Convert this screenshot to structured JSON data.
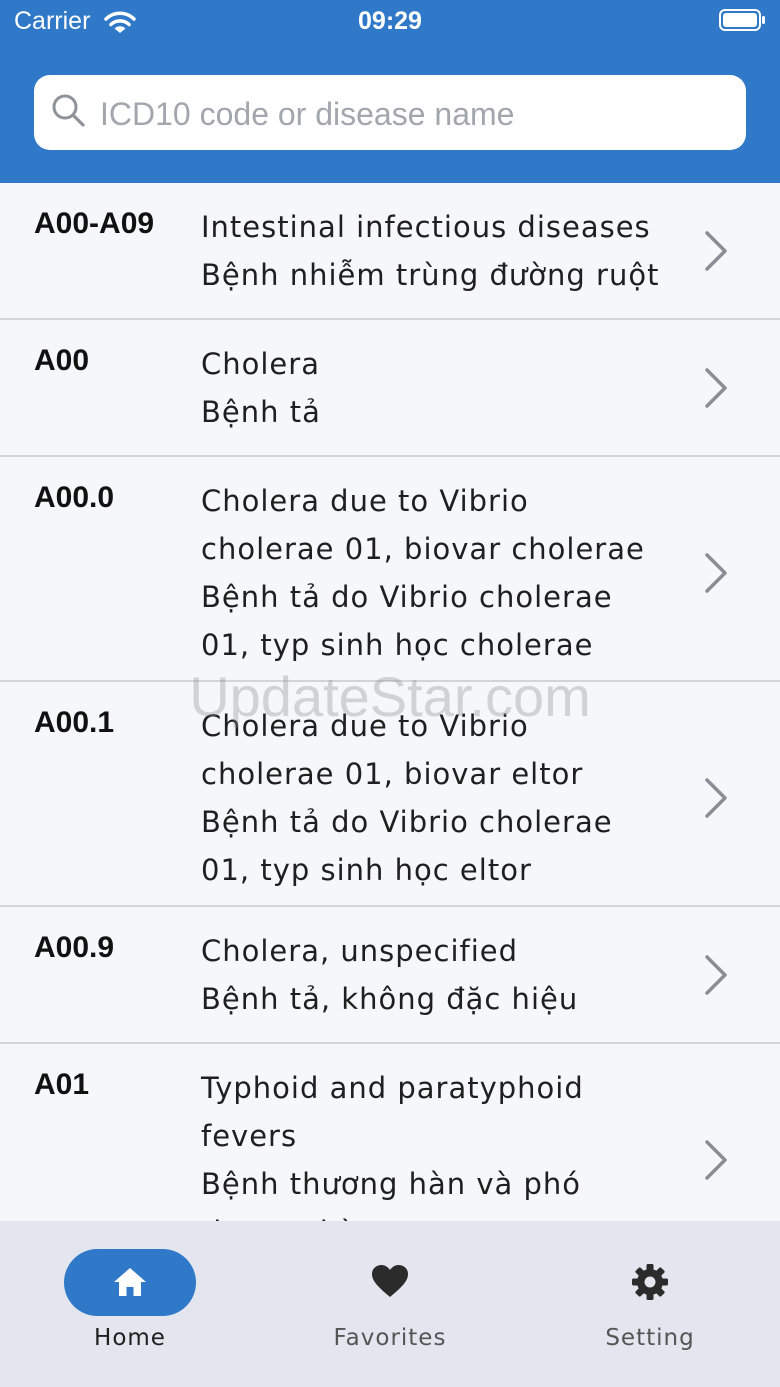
{
  "status_bar": {
    "carrier": "Carrier",
    "time": "09:29"
  },
  "search": {
    "placeholder": "ICD10 code or disease name",
    "value": ""
  },
  "items": [
    {
      "code": "A00-A09",
      "lines": [
        "Intestinal infectious diseases",
        "Bệnh nhiễm trùng đường ruột"
      ]
    },
    {
      "code": "A00",
      "lines": [
        "Cholera",
        "Bệnh tả"
      ]
    },
    {
      "code": "A00.0",
      "lines": [
        "Cholera due to Vibrio",
        "cholerae 01, biovar cholerae",
        "Bệnh tả do Vibrio cholerae",
        "01, typ sinh học cholerae"
      ]
    },
    {
      "code": "A00.1",
      "lines": [
        "Cholera due to Vibrio",
        "cholerae 01, biovar eltor",
        "Bệnh tả do Vibrio cholerae",
        "01, typ sinh học eltor"
      ]
    },
    {
      "code": "A00.9",
      "lines": [
        "Cholera, unspecified",
        "Bệnh tả, không đặc hiệu"
      ]
    },
    {
      "code": "A01",
      "lines": [
        "Typhoid and paratyphoid",
        "fevers",
        "Bệnh thương hàn và phó",
        "thương hàn"
      ]
    }
  ],
  "tabs": [
    {
      "label": "Home",
      "icon": "home-icon",
      "active": true
    },
    {
      "label": "Favorites",
      "icon": "heart-icon",
      "active": false
    },
    {
      "label": "Setting",
      "icon": "gear-icon",
      "active": false
    }
  ],
  "watermark": "UpdateStar.com",
  "colors": {
    "primary": "#2f79c8",
    "background": "#f6f7fb",
    "tabbar": "#e3e6ee",
    "icon": "#2b2b2b",
    "active_icon": "#ffffff"
  }
}
